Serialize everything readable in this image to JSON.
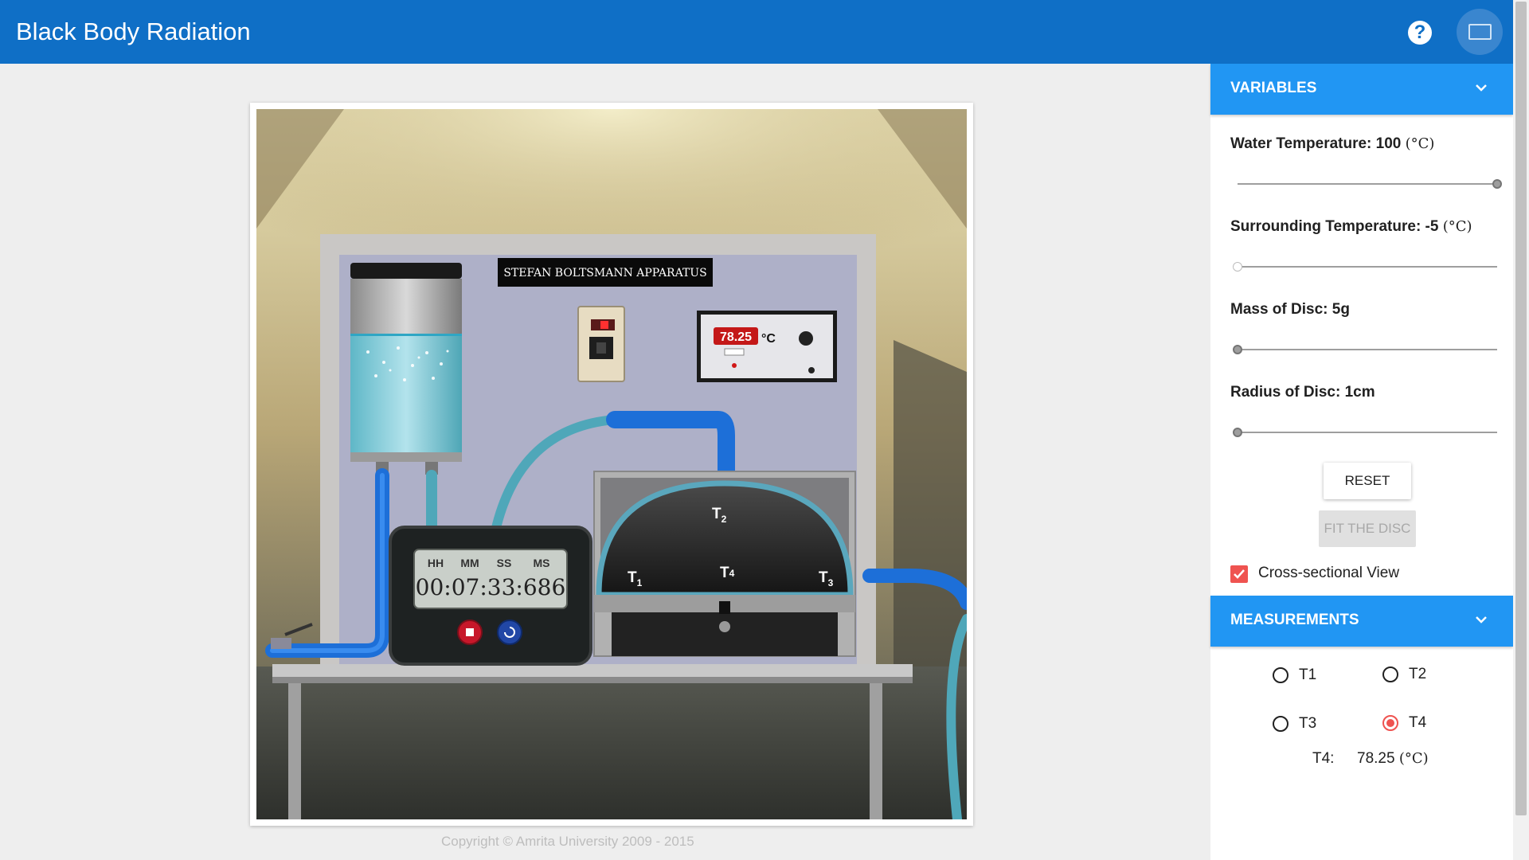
{
  "header": {
    "title": "Black Body Radiation",
    "help_icon": "help-circle-icon",
    "fullscreen_icon": "fullscreen-icon"
  },
  "simulation": {
    "apparatus_title": "STEFAN BOLTSMANN APPARATUS",
    "indicator_reading": "78.25",
    "indicator_unit": "°C",
    "stopwatch": {
      "labels": [
        "HH",
        "MM",
        "SS",
        "MS"
      ],
      "time": "00:07:33:686"
    },
    "probe_labels": [
      "T",
      "T",
      "T",
      "T"
    ],
    "probe_subs": [
      "1",
      "2",
      "3",
      "4"
    ]
  },
  "copyright": "Copyright © Amrita University 2009 - 2015",
  "variables": {
    "header": "VARIABLES",
    "water_temp_label": "Water Temperature: 100",
    "water_temp_unit": "(°C)",
    "water_temp_fraction": 1.0,
    "surrounding_temp_label": "Surrounding Temperature: -5",
    "surrounding_temp_unit": "(°C)",
    "surrounding_temp_fraction": 0.0,
    "mass_label": "Mass of Disc: 5g",
    "mass_fraction": 0.0,
    "radius_label": "Radius of Disc: 1cm",
    "radius_fraction": 0.0,
    "reset_label": "RESET",
    "fit_label": "FIT THE DISC",
    "cross_section_label": "Cross-sectional View",
    "cross_section_checked": true
  },
  "measurements": {
    "header": "MEASUREMENTS",
    "options": [
      "T1",
      "T2",
      "T3",
      "T4"
    ],
    "selected": "T4",
    "reading_name": "T4:",
    "reading_value": "78.25",
    "reading_unit": "(°C)"
  },
  "colors": {
    "header": "#0f6fc6",
    "section": "#2196f3",
    "accent": "#ef5350"
  }
}
